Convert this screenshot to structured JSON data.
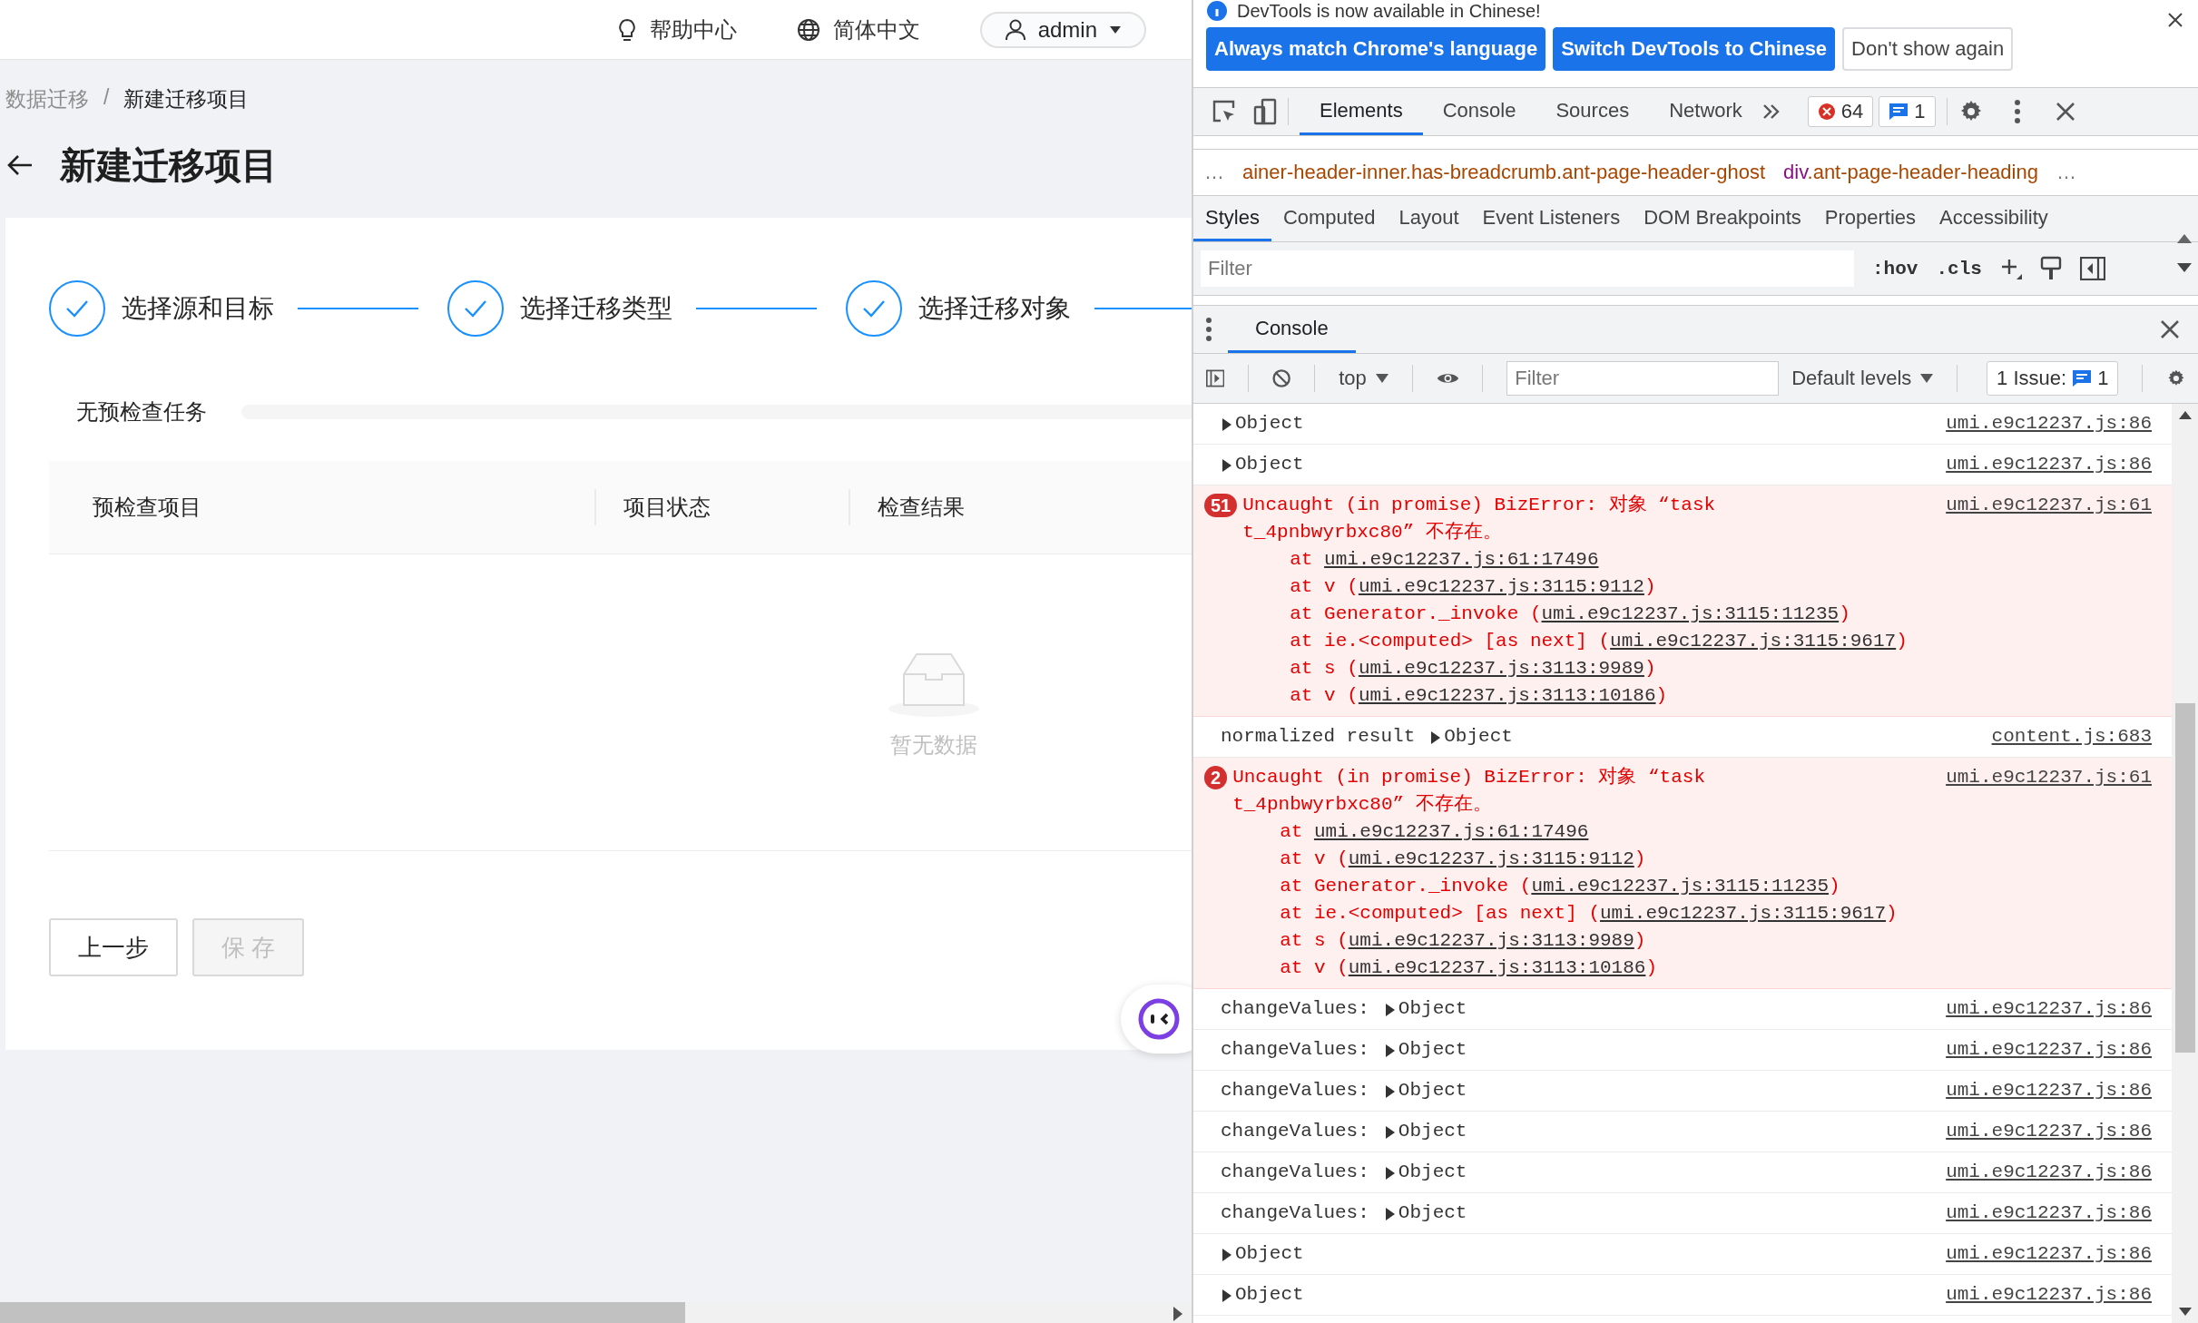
{
  "app": {
    "header": {
      "help": "帮助中心",
      "language": "简体中文",
      "user": "admin"
    },
    "breadcrumb": [
      {
        "label": "数据迁移",
        "current": false
      },
      {
        "label": "新建迁移项目",
        "current": true
      }
    ],
    "breadcrumb_separator": "/",
    "title": "新建迁移项目",
    "steps": [
      {
        "label": "选择源和目标",
        "finished": true
      },
      {
        "label": "选择迁移类型",
        "finished": true
      },
      {
        "label": "选择迁移对象",
        "finished": true
      }
    ],
    "precheck": {
      "label": "无预检查任务",
      "level": 0
    },
    "table": {
      "columns": [
        "预检查项目",
        "项目状态",
        "检查结果"
      ],
      "empty_text": "暂无数据"
    },
    "buttons": [
      {
        "label": "上一步",
        "disabled": false
      },
      {
        "label": "保 存",
        "disabled": true
      }
    ]
  },
  "devtools": {
    "infobar": {
      "message": "DevTools is now available in Chinese!",
      "buttons": [
        {
          "label": "Always match Chrome's language",
          "kind": "primary"
        },
        {
          "label": "Switch DevTools to Chinese",
          "kind": "primary"
        },
        {
          "label": "Don't show again",
          "kind": "secondary"
        }
      ]
    },
    "tabs": [
      {
        "label": "Elements",
        "selected": true
      },
      {
        "label": "Console",
        "selected": false
      },
      {
        "label": "Sources",
        "selected": false
      },
      {
        "label": "Network",
        "selected": false
      }
    ],
    "error_count": "64",
    "message_count": "1",
    "breadcrumb": [
      {
        "classes": "ainer-header-inner.has-breadcrumb.ant-page-header-ghost"
      },
      {
        "tag": "div",
        "classes": ".ant-page-header-heading"
      }
    ],
    "breadcrumb_more": "…",
    "style_tabs": [
      {
        "label": "Styles",
        "selected": true
      },
      {
        "label": "Computed",
        "selected": false
      },
      {
        "label": "Layout",
        "selected": false
      },
      {
        "label": "Event Listeners",
        "selected": false
      },
      {
        "label": "DOM Breakpoints",
        "selected": false
      },
      {
        "label": "Properties",
        "selected": false
      },
      {
        "label": "Accessibility",
        "selected": false
      }
    ],
    "styles_filter": {
      "placeholder": "Filter"
    },
    "hov": ":hov",
    "cls": ".cls",
    "drawer_tabs": [
      {
        "label": "Console",
        "selected": true
      }
    ],
    "console_toolbar": {
      "context": "top",
      "filter": {
        "placeholder": "Filter"
      },
      "levels": "Default levels",
      "issues": "1 Issue:",
      "issue_count": "1"
    },
    "messages": [
      {
        "kind": "log",
        "value": "Object",
        "source": "umi.e9c12237.js:86"
      },
      {
        "kind": "log",
        "value": "Object",
        "source": "umi.e9c12237.js:86"
      },
      {
        "kind": "error",
        "count": "51",
        "text": "Uncaught (in promise) BizError: 对象 “task t_4pnbwyrbxc80” 不存在。",
        "source": "umi.e9c12237.js:61",
        "stack": [
          {
            "before": "at ",
            "link": "umi.e9c12237.js:61:17496"
          },
          {
            "before": "at v (",
            "link": "umi.e9c12237.js:3115:9112",
            "after": ")"
          },
          {
            "before": "at Generator._invoke (",
            "link": "umi.e9c12237.js:3115:11235",
            "after": ")"
          },
          {
            "before": "at ie.<computed> [as next] (",
            "link": "umi.e9c12237.js:3115:9617",
            "after": ")"
          },
          {
            "before": "at s (",
            "link": "umi.e9c12237.js:3113:9989",
            "after": ")"
          },
          {
            "before": "at v (",
            "link": "umi.e9c12237.js:3113:10186",
            "after": ")"
          }
        ]
      },
      {
        "kind": "log",
        "prefix": "normalized result",
        "value": "Object",
        "source": "content.js:683"
      },
      {
        "kind": "error",
        "count": "2",
        "text": "Uncaught (in promise) BizError: 对象 “task t_4pnbwyrbxc80” 不存在。",
        "source": "umi.e9c12237.js:61",
        "stack": [
          {
            "before": "at ",
            "link": "umi.e9c12237.js:61:17496"
          },
          {
            "before": "at v (",
            "link": "umi.e9c12237.js:3115:9112",
            "after": ")"
          },
          {
            "before": "at Generator._invoke (",
            "link": "umi.e9c12237.js:3115:11235",
            "after": ")"
          },
          {
            "before": "at ie.<computed> [as next] (",
            "link": "umi.e9c12237.js:3115:9617",
            "after": ")"
          },
          {
            "before": "at s (",
            "link": "umi.e9c12237.js:3113:9989",
            "after": ")"
          },
          {
            "before": "at v (",
            "link": "umi.e9c12237.js:3113:10186",
            "after": ")"
          }
        ]
      },
      {
        "kind": "log",
        "prefix": "changeValues:",
        "value": "Object",
        "source": "umi.e9c12237.js:86"
      },
      {
        "kind": "log",
        "prefix": "changeValues:",
        "value": "Object",
        "source": "umi.e9c12237.js:86"
      },
      {
        "kind": "log",
        "prefix": "changeValues:",
        "value": "Object",
        "source": "umi.e9c12237.js:86"
      },
      {
        "kind": "log",
        "prefix": "changeValues:",
        "value": "Object",
        "source": "umi.e9c12237.js:86"
      },
      {
        "kind": "log",
        "prefix": "changeValues:",
        "value": "Object",
        "source": "umi.e9c12237.js:86"
      },
      {
        "kind": "log",
        "prefix": "changeValues:",
        "value": "Object",
        "source": "umi.e9c12237.js:86"
      },
      {
        "kind": "log",
        "value": "Object",
        "source": "umi.e9c12237.js:86"
      },
      {
        "kind": "log",
        "value": "Object",
        "source": "umi.e9c12237.js:86"
      }
    ]
  }
}
